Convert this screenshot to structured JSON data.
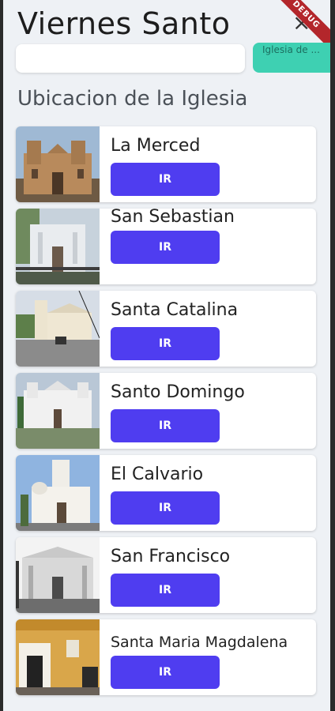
{
  "header": {
    "title": "Viernes Santo",
    "debug_label": "DEBUG"
  },
  "top_cards": {
    "teal_text": "Iglesia de ..."
  },
  "section": {
    "title": "Ubicacion de la Iglesia"
  },
  "churches": [
    {
      "name": "La Merced",
      "button": "IR",
      "photo_icon": "church-photo"
    },
    {
      "name": "San Sebastian",
      "button": "IR",
      "photo_icon": "church-photo"
    },
    {
      "name": "Santa Catalina",
      "button": "IR",
      "photo_icon": "church-photo"
    },
    {
      "name": "Santo Domingo",
      "button": "IR",
      "photo_icon": "church-photo"
    },
    {
      "name": "El Calvario",
      "button": "IR",
      "photo_icon": "church-photo"
    },
    {
      "name": "San Francisco",
      "button": "IR",
      "photo_icon": "church-photo"
    },
    {
      "name": "Santa Maria Magdalena",
      "button": "IR",
      "photo_icon": "church-photo"
    }
  ],
  "colors": {
    "button": "#4f3df0",
    "teal": "#3ed0b2",
    "background": "#eef1f5"
  }
}
